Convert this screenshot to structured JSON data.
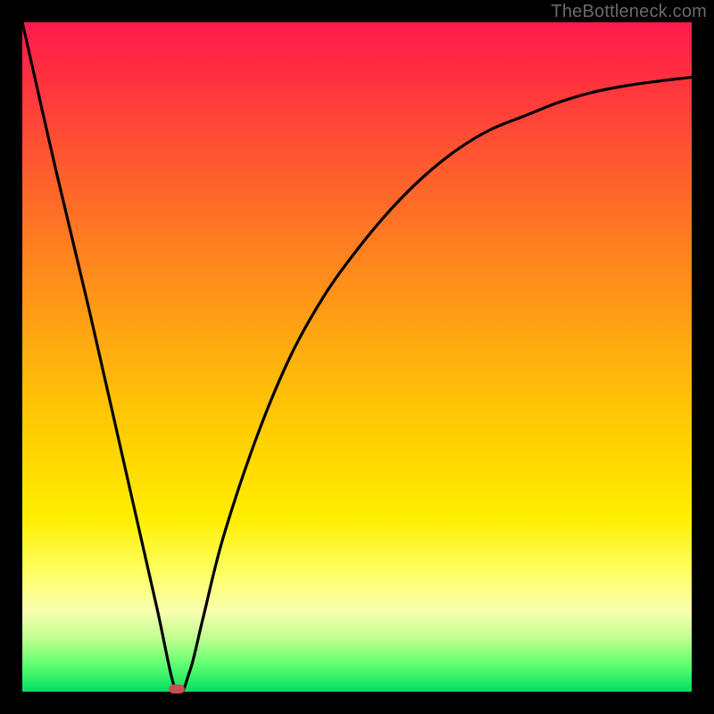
{
  "attribution": "TheBottleneck.com",
  "colors": {
    "frame": "#000000",
    "curve": "#000000",
    "marker": "#c94f55",
    "gradient_top": "#ff1a4d",
    "gradient_bottom": "#00e060"
  },
  "chart_data": {
    "type": "line",
    "title": "",
    "xlabel": "",
    "ylabel": "",
    "xlim": [
      0,
      100
    ],
    "ylim": [
      0,
      100
    ],
    "grid": false,
    "legend": false,
    "series": [
      {
        "name": "bottleneck-curve",
        "x": [
          0,
          5,
          10,
          15,
          20,
          23,
          25,
          27,
          30,
          35,
          40,
          45,
          50,
          55,
          60,
          65,
          70,
          75,
          80,
          85,
          90,
          95,
          100
        ],
        "y": [
          100,
          78,
          57,
          35,
          13,
          0,
          3,
          11,
          23,
          38,
          50,
          59,
          66,
          72,
          77,
          81,
          84,
          86,
          88,
          89.5,
          90.5,
          91.2,
          91.8
        ]
      }
    ],
    "annotations": [
      {
        "type": "marker",
        "x": 23,
        "y": 0,
        "shape": "pill",
        "color": "#c94f55"
      }
    ]
  }
}
